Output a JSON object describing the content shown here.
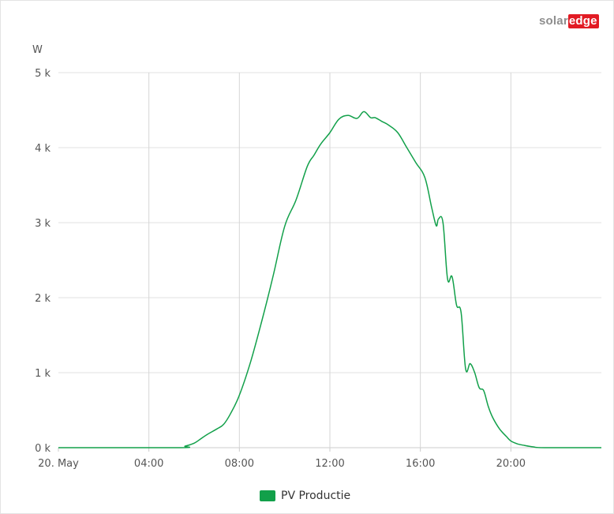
{
  "logo": {
    "solar": "solar",
    "edge": "edge"
  },
  "chart_data": {
    "type": "line",
    "title": "",
    "xlabel": "",
    "ylabel": "W",
    "ylim": [
      0,
      5000
    ],
    "xlim": [
      "20. May 00:00",
      "20. May 24:00"
    ],
    "y_ticks": [
      {
        "value": 0,
        "label": "0 k"
      },
      {
        "value": 1000,
        "label": "1 k"
      },
      {
        "value": 2000,
        "label": "2 k"
      },
      {
        "value": 3000,
        "label": "3 k"
      },
      {
        "value": 4000,
        "label": "4 k"
      },
      {
        "value": 5000,
        "label": "5 k"
      }
    ],
    "x_ticks": [
      {
        "value": 0,
        "label": "20. May"
      },
      {
        "value": 4,
        "label": "04:00"
      },
      {
        "value": 8,
        "label": "08:00"
      },
      {
        "value": 12,
        "label": "12:00"
      },
      {
        "value": 16,
        "label": "16:00"
      },
      {
        "value": 20,
        "label": "20:00"
      }
    ],
    "grid": true,
    "legend_position": "bottom",
    "series": [
      {
        "name": "PV Productie",
        "color": "#12a04a",
        "x": [
          0,
          5.3,
          5.6,
          6.0,
          6.3,
          6.6,
          7.0,
          7.3,
          7.6,
          8.0,
          8.5,
          9.0,
          9.5,
          10.0,
          10.5,
          11.0,
          11.3,
          11.6,
          12.0,
          12.4,
          12.8,
          13.2,
          13.5,
          13.8,
          14.0,
          14.3,
          14.6,
          15.0,
          15.4,
          15.8,
          16.2,
          16.5,
          16.7,
          16.8,
          17.0,
          17.2,
          17.4,
          17.6,
          17.8,
          18.0,
          18.2,
          18.4,
          18.6,
          18.8,
          19.0,
          19.2,
          19.5,
          19.8,
          20.0,
          20.3,
          20.6,
          21.0,
          21.5,
          24
        ],
        "values": [
          0,
          0,
          20,
          60,
          120,
          180,
          250,
          310,
          450,
          700,
          1150,
          1700,
          2300,
          2950,
          3300,
          3750,
          3900,
          4050,
          4200,
          4380,
          4430,
          4390,
          4480,
          4400,
          4400,
          4350,
          4300,
          4200,
          4000,
          3800,
          3600,
          3200,
          2960,
          3050,
          3000,
          2250,
          2280,
          1900,
          1800,
          1050,
          1120,
          1000,
          800,
          760,
          550,
          400,
          250,
          150,
          90,
          50,
          30,
          10,
          0,
          0
        ]
      }
    ]
  }
}
